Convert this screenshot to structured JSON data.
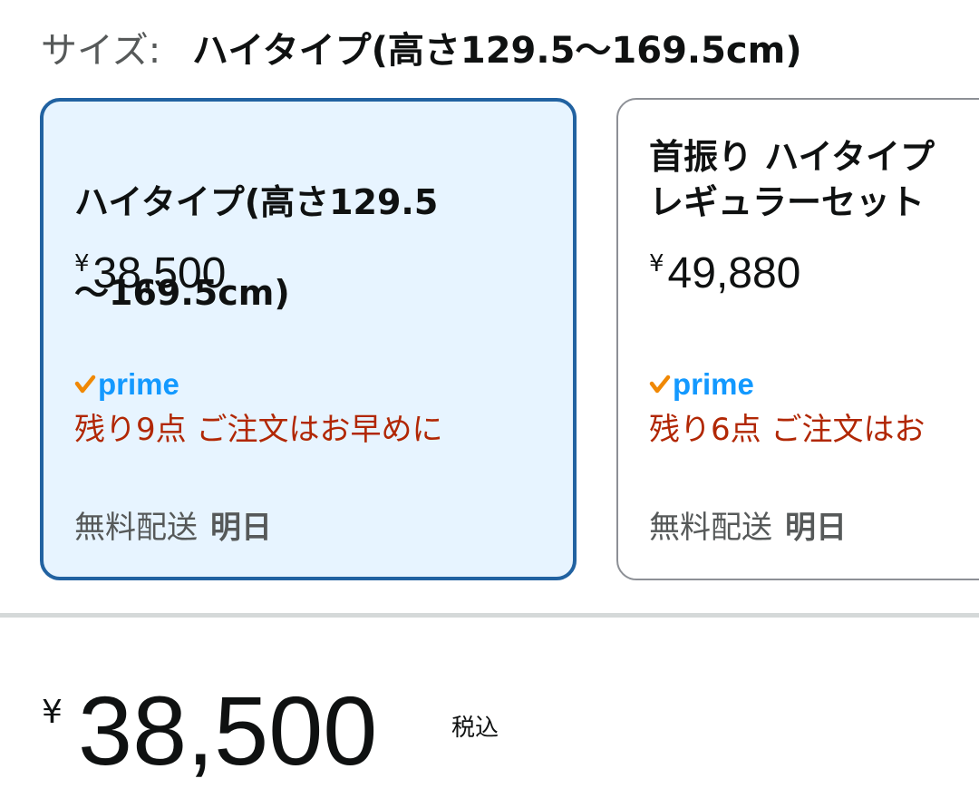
{
  "size_selector": {
    "label": "サイズ:",
    "selected_value": "ハイタイプ(高さ129.5〜169.5cm)"
  },
  "options": [
    {
      "title_lines": [
        "ハイタイプ(高さ129.5",
        "〜169.5cm)"
      ],
      "currency": "¥",
      "price": "38,500",
      "badge": "prime",
      "stock": "残り9点 ご注文はお早めに",
      "delivery_label": "無料配送",
      "delivery_day": "明日",
      "selected": true
    },
    {
      "title_lines": [
        "首振り ハイタイプ",
        "レギュラーセット"
      ],
      "currency": "¥",
      "price": "49,880",
      "badge": "prime",
      "stock": "残り6点 ご注文はお",
      "delivery_label": "無料配送",
      "delivery_day": "明日",
      "selected": false
    }
  ],
  "total": {
    "currency": "¥",
    "price": "38,500",
    "tax_note": "税込"
  },
  "colors": {
    "selected_border": "#2162a1",
    "selected_bg": "#e7f4ff",
    "prime_blue": "#1399ff",
    "prime_check": "#f08804",
    "stock_red": "#b12704",
    "divider": "#d5d9d9"
  }
}
